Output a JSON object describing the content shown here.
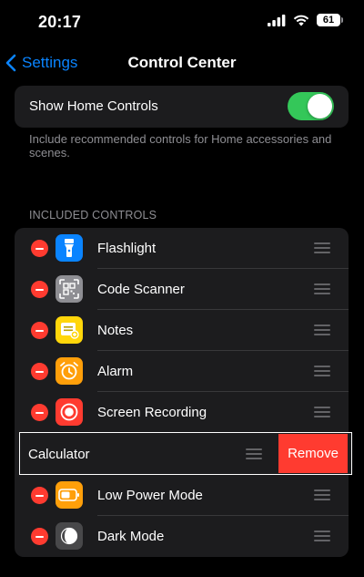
{
  "status_bar": {
    "time": "20:17",
    "battery": "61",
    "icons": [
      "signal-icon",
      "wifi-icon",
      "battery-icon"
    ]
  },
  "nav": {
    "back_label": "Settings",
    "title": "Control Center"
  },
  "home_controls": {
    "label": "Show Home Controls",
    "enabled": true,
    "description": "Include recommended controls for Home accessories and scenes."
  },
  "section_header": "INCLUDED CONTROLS",
  "controls": [
    {
      "label": "Flashlight",
      "icon": "flashlight-icon",
      "icon_color": "#0a84ff"
    },
    {
      "label": "Code Scanner",
      "icon": "qr-code-icon",
      "icon_color": "#8e8e93"
    },
    {
      "label": "Notes",
      "icon": "notes-icon",
      "icon_color": "#ffd60a"
    },
    {
      "label": "Alarm",
      "icon": "alarm-clock-icon",
      "icon_color": "#ff9f0a"
    },
    {
      "label": "Screen Recording",
      "icon": "record-icon",
      "icon_color": "#ff3b30"
    },
    {
      "label": "Low Power Mode",
      "icon": "battery-low-power-icon",
      "icon_color": "#ff9f0a"
    },
    {
      "label": "Dark Mode",
      "icon": "dark-mode-icon",
      "icon_color": "#48484a"
    }
  ],
  "swiped_row": {
    "label": "Calculator",
    "action_label": "Remove"
  },
  "colors": {
    "accent": "#0a84ff",
    "toggle_on": "#34c759",
    "destructive": "#ff3b30",
    "cell_background": "#1c1c1e",
    "secondary_text": "#8e8e93"
  }
}
